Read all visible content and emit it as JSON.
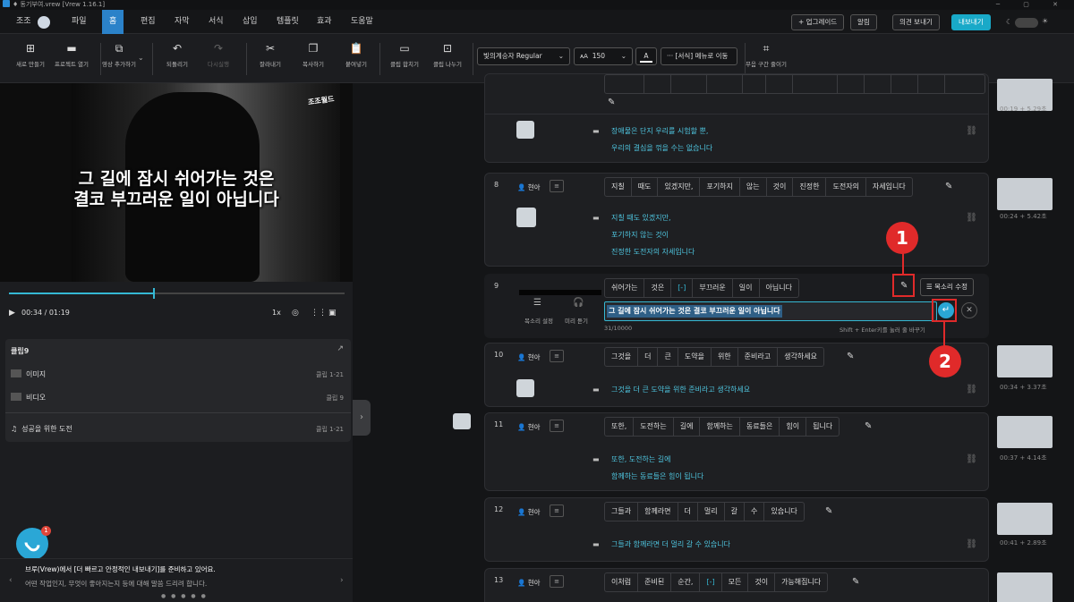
{
  "app": {
    "title": "♦ 동기부여.vrew [Vrew 1.16.1]"
  },
  "menu": {
    "user": "조조",
    "items": [
      "파일",
      "홈",
      "편집",
      "자막",
      "서식",
      "삽입",
      "템플릿",
      "효과",
      "도움말"
    ],
    "active": "홈",
    "buttons": {
      "upgrade": "+ 업그레이드",
      "alarm": "알림",
      "export": "의견 보내기",
      "share": "내보내기"
    }
  },
  "toolbar": {
    "tools": [
      {
        "label": "새로 만들기",
        "icon": "plus-icon"
      },
      {
        "label": "프로젝트 열기",
        "icon": "folder-icon"
      },
      {
        "label": "영상 추가하기",
        "icon": "video-add-icon"
      },
      {
        "label": "되돌리기",
        "icon": "undo-icon"
      },
      {
        "label": "다시실행",
        "icon": "redo-icon",
        "disabled": true
      },
      {
        "label": "잘라내기",
        "icon": "scissors-icon"
      },
      {
        "label": "복사하기",
        "icon": "copy-icon"
      },
      {
        "label": "붙여넣기",
        "icon": "paste-icon"
      },
      {
        "label": "클립 합치기",
        "icon": "merge-icon"
      },
      {
        "label": "클립 나누기",
        "icon": "split-icon"
      },
      {
        "label": "무음 구간 줄이기",
        "icon": "silence-icon"
      }
    ],
    "font": "빛의계승자 Regular",
    "font_size": "150",
    "more": "··· [서식] 메뉴로 이동"
  },
  "player": {
    "subtitle_line1": "그 길에 잠시 쉬어가는 것은",
    "subtitle_line2": "결코 부끄러운 일이 아닙니다",
    "watermark": "조조월드",
    "time": "00:34 / 01:19",
    "speed": "1x",
    "progress": 0.43
  },
  "clip_panel": {
    "title": "클립9",
    "rows": [
      {
        "label": "이미지",
        "meta": "클립 1-21"
      },
      {
        "label": "비디오",
        "meta": "클립 9"
      },
      {
        "label": "성공을 위한 도전",
        "meta": "클립 1-21"
      }
    ]
  },
  "notice": {
    "line1": "브루(Vrew)에서 [더 빠르고 안정적인 내보내기]를 준비하고 있어요.",
    "line2": "어떤 작업인지, 무엇이 좋아지는지 등에 대해 말씀 드리려 합니다.",
    "chat_badge": "1"
  },
  "clips": [
    {
      "num": "",
      "speaker": "",
      "words": [
        "",
        "",
        "",
        "",
        "",
        "",
        "",
        "",
        "",
        "",
        "",
        ""
      ],
      "lines": [
        "장애물은 단지 우리를 시험할 뿐,",
        "우리의 결심을 꺾을 수는 없습니다"
      ],
      "time": "00:19 + 5.29초"
    },
    {
      "num": "8",
      "speaker": "현아",
      "words": [
        "지칠",
        "때도",
        "있겠지만,",
        "포기하지",
        "않는",
        "것이",
        "진정한",
        "도전자의",
        "자세입니다"
      ],
      "lines": [
        "지칠 때도 있겠지만,",
        "포기하지 않는 것이",
        "진정한 도전자의 자세입니다"
      ],
      "time": "00:24 + 5.42초"
    },
    {
      "num": "9",
      "speaker": "",
      "words": [
        "쉬어가는",
        "것은",
        "[-]",
        "부끄러운",
        "일이",
        "아닙니다"
      ],
      "edit_text": "그 길에 잠시 쉬어가는 것은 결코 부끄러운 일이 아닙니다",
      "counter": "31/10000",
      "hint": "Shift + Enter키를 눌러 줄 바꾸기",
      "voice_btn": "목소리 수정",
      "voice_set": "목소리 설정",
      "preview": "미리 듣기",
      "time": ""
    },
    {
      "num": "10",
      "speaker": "현아",
      "words": [
        "그것을",
        "더",
        "큰",
        "도약을",
        "위한",
        "준비라고",
        "생각하세요"
      ],
      "lines": [
        "그것을 더 큰 도약을 위한 준비라고 생각하세요"
      ],
      "time": "00:34 + 3.37초"
    },
    {
      "num": "11",
      "speaker": "현아",
      "words": [
        "또한,",
        "도전하는",
        "길에",
        "함께하는",
        "동료들은",
        "힘이",
        "됩니다"
      ],
      "lines": [
        "또한, 도전하는 길에",
        "함께하는 동료들은 힘이 됩니다"
      ],
      "time": "00:37 + 4.14초"
    },
    {
      "num": "12",
      "speaker": "현아",
      "words": [
        "그들과",
        "함께라면",
        "더",
        "멀리",
        "갈",
        "수",
        "있습니다"
      ],
      "lines": [
        "그들과 함께라면 더 멀리 갈 수 있습니다"
      ],
      "time": "00:41 + 2.89초"
    },
    {
      "num": "13",
      "speaker": "현아",
      "words": [
        "이처럼",
        "준비된",
        "순간,",
        "[-]",
        "모든",
        "것이",
        "가능해집니다"
      ],
      "lines": [],
      "time": ""
    }
  ],
  "badges": [
    "1",
    "2"
  ]
}
